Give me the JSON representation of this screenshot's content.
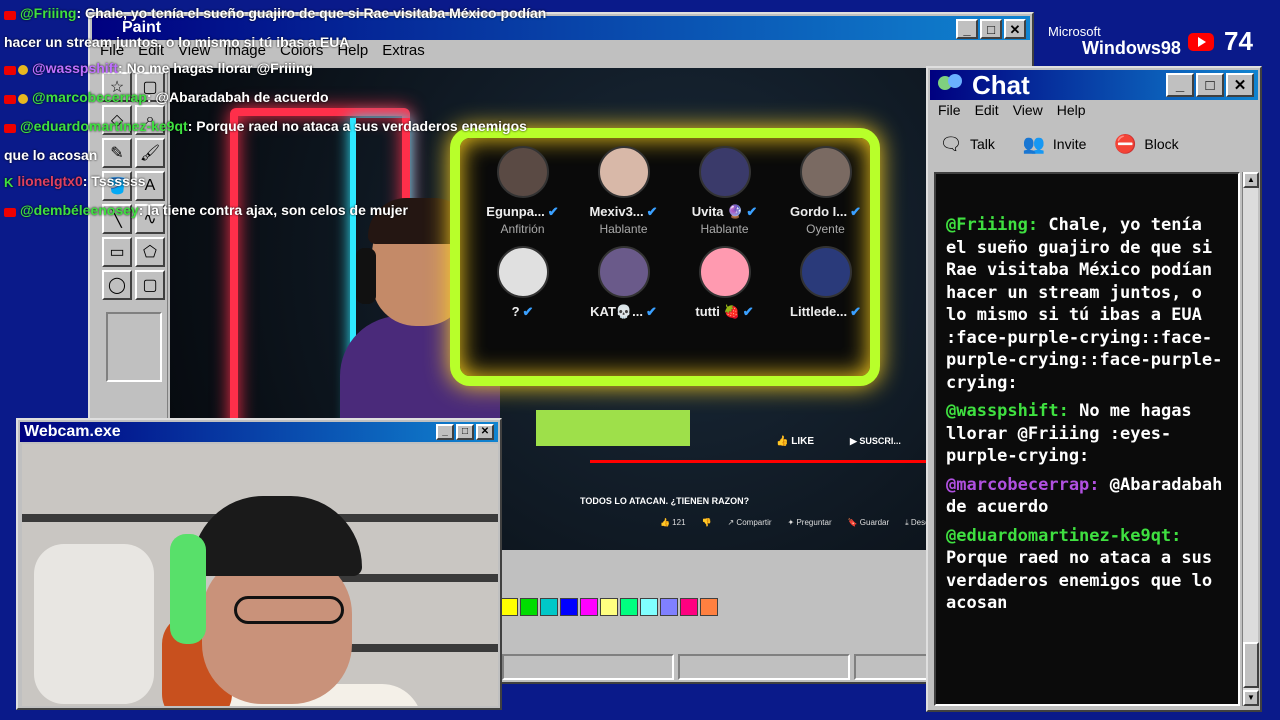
{
  "overlay_chat": [
    {
      "user": "@Friiing",
      "user_color": "#3fe040",
      "text": ": Chale, yo tenía el sueño guajiro de que si Rae visitaba México podían",
      "badges": [
        "yt"
      ]
    },
    {
      "user": "",
      "user_color": "#fff",
      "text": "hacer un stream juntos, o lo mismo si tú ibas a EUA",
      "badges": []
    },
    {
      "user": "@wasspshift",
      "user_color": "#c070ff",
      "text": ": No me hagas llorar @Friiing",
      "badges": [
        "yt",
        "gold"
      ]
    },
    {
      "user": "@marcobecerrap",
      "user_color": "#3fe040",
      "text": ": @Abaradabah de acuerdo",
      "badges": [
        "yt",
        "gold"
      ]
    },
    {
      "user": "@eduardomartinez-ke9qt",
      "user_color": "#3fe040",
      "text": ": Porque raed no ataca a sus verdaderos enemigos",
      "badges": [
        "yt"
      ]
    },
    {
      "user": "",
      "user_color": "#fff",
      "text": "que lo acosan",
      "badges": []
    },
    {
      "user": "lionelgtx0",
      "user_color": "#e04060",
      "text": ": Tssssss",
      "badges": [
        "k"
      ]
    },
    {
      "user": "@dembéleenosey",
      "user_color": "#3fe040",
      "text": ": la tiene contra ajax, son celos de mujer",
      "badges": [
        "yt"
      ]
    }
  ],
  "paint": {
    "title": "Paint",
    "menu": [
      "File",
      "Edit",
      "View",
      "Image",
      "Colors",
      "Help",
      "Extras"
    ],
    "tools": [
      "☆",
      "▢",
      "◇",
      "⌕",
      "✎",
      "🖌",
      "🪣",
      "A",
      "╲",
      "∿",
      "▭",
      "⬠",
      "◯",
      "▢"
    ],
    "palette": [
      "#ffff00",
      "#00dd00",
      "#00c8c8",
      "#0000ff",
      "#ff00ff",
      "#ffff80",
      "#00ff80",
      "#80ffff",
      "#8080ff",
      "#ff0080",
      "#ff8040"
    ],
    "video": {
      "participants": [
        {
          "name": "Egunpa...",
          "role": "Anfitrión",
          "avatar": "#5a4a44"
        },
        {
          "name": "Mexiv3...",
          "role": "Hablante",
          "avatar": "#d8b8a8"
        },
        {
          "name": "Uvita 🔮",
          "role": "Hablante",
          "avatar": "#3a3a6a"
        },
        {
          "name": "Gordo I...",
          "role": "Oyente",
          "avatar": "#7a6a62"
        },
        {
          "name": "?",
          "role": "",
          "avatar": "#e0e0e0"
        },
        {
          "name": "KAT💀...",
          "role": "",
          "avatar": "#6a5a8a"
        },
        {
          "name": "tutti 🍓",
          "role": "",
          "avatar": "#ff9ab0"
        },
        {
          "name": "Littlede...",
          "role": "",
          "avatar": "#2a3a7a"
        }
      ],
      "video_title": "TODOS LO ATACAN. ¿TIENEN RAZON?",
      "actions": [
        "👍 121",
        "👎",
        "↗ Compartir",
        "✦ Preguntar",
        "🔖 Guardar",
        "⤓ Descargar",
        "⋯"
      ],
      "like_label": "LIKE",
      "subscribe_label": "SUSCRI...",
      "progress": 0.95
    }
  },
  "chat": {
    "title": "Chat",
    "menu": [
      "File",
      "Edit",
      "View",
      "Help"
    ],
    "toolbar": [
      {
        "label": "Talk",
        "icon": "talk-icon",
        "glyph": "🗨"
      },
      {
        "label": "Invite",
        "icon": "invite-icon",
        "glyph": "👥"
      },
      {
        "label": "Block",
        "icon": "block-icon",
        "glyph": "⛔"
      }
    ],
    "messages": [
      {
        "user": "@Friiing:",
        "user_color": "#3fe040",
        "text": "Chale, yo tenía el sueño guajiro de que si Rae visitaba México podían hacer un stream juntos, o lo mismo si tú ibas a EUA :face-purple-crying::face-purple-crying::face-purple-crying:"
      },
      {
        "user": "@wasspshift:",
        "user_color": "#3fe040",
        "text": "No me hagas llorar @Friiing :eyes-purple-crying:"
      },
      {
        "user": "@marcobecerrap:",
        "user_color": "#b050e0",
        "text": "@Abaradabah de acuerdo"
      },
      {
        "user": "@eduardomartinez-ke9qt:",
        "user_color": "#3fe040",
        "text": "Porque raed no ataca a sus verdaderos enemigos que lo acosan"
      }
    ]
  },
  "webcam": {
    "title": "Webcam.exe"
  },
  "brand": {
    "microsoft": "Microsoft",
    "windows": "Windows98"
  },
  "viewers": {
    "count": "74"
  }
}
